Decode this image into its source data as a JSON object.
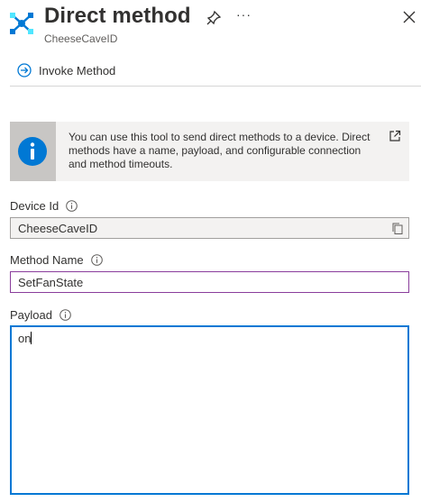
{
  "header": {
    "title": "Direct method",
    "subtitle": "CheeseCaveID",
    "icons": [
      "iot-hub-icon",
      "pin-icon",
      "more-options-icon",
      "close-icon"
    ]
  },
  "toolbar": {
    "invoke_label": "Invoke Method",
    "invoke_icon": "arrow-circle-icon"
  },
  "info_banner": {
    "text": "You can use this tool to send direct methods to a device. Direct methods have a name, payload, and configurable connection and method timeouts.",
    "icon": "info-icon",
    "link_icon": "external-link-icon"
  },
  "fields": {
    "device_id": {
      "label": "Device Id",
      "value": "CheeseCaveID"
    },
    "method_name": {
      "label": "Method Name",
      "value": "SetFanState"
    },
    "payload": {
      "label": "Payload",
      "value": "on"
    }
  },
  "colors": {
    "accent": "#0078d4",
    "focus_border": "#8a3d9c",
    "banner_bg": "#f3f2f1",
    "banner_icon_bg": "#c8c6c4"
  }
}
